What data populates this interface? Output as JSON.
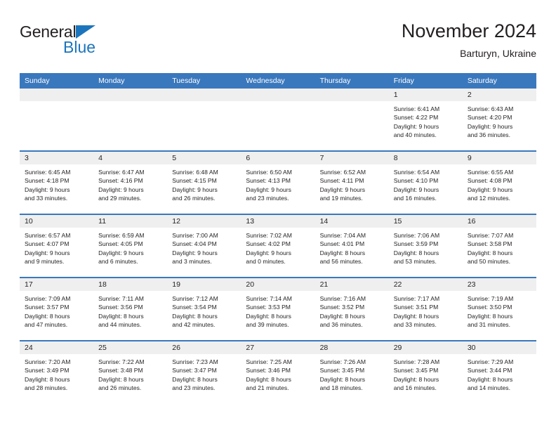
{
  "brand": {
    "name_part1": "General",
    "name_part2": "Blue",
    "triangle_color": "#1c75bc"
  },
  "header": {
    "title": "November 2024",
    "subtitle": "Barturyn, Ukraine"
  },
  "theme": {
    "header_bg": "#3a78bd",
    "daynum_bg": "#efefef",
    "text": "#231f20",
    "row_border": "#3a78bd"
  },
  "weekday_headers": [
    "Sunday",
    "Monday",
    "Tuesday",
    "Wednesday",
    "Thursday",
    "Friday",
    "Saturday"
  ],
  "weeks": [
    [
      {
        "day": "",
        "sunrise": "",
        "sunset": "",
        "daylight1": "",
        "daylight2": "",
        "empty": true
      },
      {
        "day": "",
        "sunrise": "",
        "sunset": "",
        "daylight1": "",
        "daylight2": "",
        "empty": true
      },
      {
        "day": "",
        "sunrise": "",
        "sunset": "",
        "daylight1": "",
        "daylight2": "",
        "empty": true
      },
      {
        "day": "",
        "sunrise": "",
        "sunset": "",
        "daylight1": "",
        "daylight2": "",
        "empty": true
      },
      {
        "day": "",
        "sunrise": "",
        "sunset": "",
        "daylight1": "",
        "daylight2": "",
        "empty": true
      },
      {
        "day": "1",
        "sunrise": "Sunrise: 6:41 AM",
        "sunset": "Sunset: 4:22 PM",
        "daylight1": "Daylight: 9 hours",
        "daylight2": "and 40 minutes.",
        "empty": false
      },
      {
        "day": "2",
        "sunrise": "Sunrise: 6:43 AM",
        "sunset": "Sunset: 4:20 PM",
        "daylight1": "Daylight: 9 hours",
        "daylight2": "and 36 minutes.",
        "empty": false
      }
    ],
    [
      {
        "day": "3",
        "sunrise": "Sunrise: 6:45 AM",
        "sunset": "Sunset: 4:18 PM",
        "daylight1": "Daylight: 9 hours",
        "daylight2": "and 33 minutes.",
        "empty": false
      },
      {
        "day": "4",
        "sunrise": "Sunrise: 6:47 AM",
        "sunset": "Sunset: 4:16 PM",
        "daylight1": "Daylight: 9 hours",
        "daylight2": "and 29 minutes.",
        "empty": false
      },
      {
        "day": "5",
        "sunrise": "Sunrise: 6:48 AM",
        "sunset": "Sunset: 4:15 PM",
        "daylight1": "Daylight: 9 hours",
        "daylight2": "and 26 minutes.",
        "empty": false
      },
      {
        "day": "6",
        "sunrise": "Sunrise: 6:50 AM",
        "sunset": "Sunset: 4:13 PM",
        "daylight1": "Daylight: 9 hours",
        "daylight2": "and 23 minutes.",
        "empty": false
      },
      {
        "day": "7",
        "sunrise": "Sunrise: 6:52 AM",
        "sunset": "Sunset: 4:11 PM",
        "daylight1": "Daylight: 9 hours",
        "daylight2": "and 19 minutes.",
        "empty": false
      },
      {
        "day": "8",
        "sunrise": "Sunrise: 6:54 AM",
        "sunset": "Sunset: 4:10 PM",
        "daylight1": "Daylight: 9 hours",
        "daylight2": "and 16 minutes.",
        "empty": false
      },
      {
        "day": "9",
        "sunrise": "Sunrise: 6:55 AM",
        "sunset": "Sunset: 4:08 PM",
        "daylight1": "Daylight: 9 hours",
        "daylight2": "and 12 minutes.",
        "empty": false
      }
    ],
    [
      {
        "day": "10",
        "sunrise": "Sunrise: 6:57 AM",
        "sunset": "Sunset: 4:07 PM",
        "daylight1": "Daylight: 9 hours",
        "daylight2": "and 9 minutes.",
        "empty": false
      },
      {
        "day": "11",
        "sunrise": "Sunrise: 6:59 AM",
        "sunset": "Sunset: 4:05 PM",
        "daylight1": "Daylight: 9 hours",
        "daylight2": "and 6 minutes.",
        "empty": false
      },
      {
        "day": "12",
        "sunrise": "Sunrise: 7:00 AM",
        "sunset": "Sunset: 4:04 PM",
        "daylight1": "Daylight: 9 hours",
        "daylight2": "and 3 minutes.",
        "empty": false
      },
      {
        "day": "13",
        "sunrise": "Sunrise: 7:02 AM",
        "sunset": "Sunset: 4:02 PM",
        "daylight1": "Daylight: 9 hours",
        "daylight2": "and 0 minutes.",
        "empty": false
      },
      {
        "day": "14",
        "sunrise": "Sunrise: 7:04 AM",
        "sunset": "Sunset: 4:01 PM",
        "daylight1": "Daylight: 8 hours",
        "daylight2": "and 56 minutes.",
        "empty": false
      },
      {
        "day": "15",
        "sunrise": "Sunrise: 7:06 AM",
        "sunset": "Sunset: 3:59 PM",
        "daylight1": "Daylight: 8 hours",
        "daylight2": "and 53 minutes.",
        "empty": false
      },
      {
        "day": "16",
        "sunrise": "Sunrise: 7:07 AM",
        "sunset": "Sunset: 3:58 PM",
        "daylight1": "Daylight: 8 hours",
        "daylight2": "and 50 minutes.",
        "empty": false
      }
    ],
    [
      {
        "day": "17",
        "sunrise": "Sunrise: 7:09 AM",
        "sunset": "Sunset: 3:57 PM",
        "daylight1": "Daylight: 8 hours",
        "daylight2": "and 47 minutes.",
        "empty": false
      },
      {
        "day": "18",
        "sunrise": "Sunrise: 7:11 AM",
        "sunset": "Sunset: 3:56 PM",
        "daylight1": "Daylight: 8 hours",
        "daylight2": "and 44 minutes.",
        "empty": false
      },
      {
        "day": "19",
        "sunrise": "Sunrise: 7:12 AM",
        "sunset": "Sunset: 3:54 PM",
        "daylight1": "Daylight: 8 hours",
        "daylight2": "and 42 minutes.",
        "empty": false
      },
      {
        "day": "20",
        "sunrise": "Sunrise: 7:14 AM",
        "sunset": "Sunset: 3:53 PM",
        "daylight1": "Daylight: 8 hours",
        "daylight2": "and 39 minutes.",
        "empty": false
      },
      {
        "day": "21",
        "sunrise": "Sunrise: 7:16 AM",
        "sunset": "Sunset: 3:52 PM",
        "daylight1": "Daylight: 8 hours",
        "daylight2": "and 36 minutes.",
        "empty": false
      },
      {
        "day": "22",
        "sunrise": "Sunrise: 7:17 AM",
        "sunset": "Sunset: 3:51 PM",
        "daylight1": "Daylight: 8 hours",
        "daylight2": "and 33 minutes.",
        "empty": false
      },
      {
        "day": "23",
        "sunrise": "Sunrise: 7:19 AM",
        "sunset": "Sunset: 3:50 PM",
        "daylight1": "Daylight: 8 hours",
        "daylight2": "and 31 minutes.",
        "empty": false
      }
    ],
    [
      {
        "day": "24",
        "sunrise": "Sunrise: 7:20 AM",
        "sunset": "Sunset: 3:49 PM",
        "daylight1": "Daylight: 8 hours",
        "daylight2": "and 28 minutes.",
        "empty": false
      },
      {
        "day": "25",
        "sunrise": "Sunrise: 7:22 AM",
        "sunset": "Sunset: 3:48 PM",
        "daylight1": "Daylight: 8 hours",
        "daylight2": "and 26 minutes.",
        "empty": false
      },
      {
        "day": "26",
        "sunrise": "Sunrise: 7:23 AM",
        "sunset": "Sunset: 3:47 PM",
        "daylight1": "Daylight: 8 hours",
        "daylight2": "and 23 minutes.",
        "empty": false
      },
      {
        "day": "27",
        "sunrise": "Sunrise: 7:25 AM",
        "sunset": "Sunset: 3:46 PM",
        "daylight1": "Daylight: 8 hours",
        "daylight2": "and 21 minutes.",
        "empty": false
      },
      {
        "day": "28",
        "sunrise": "Sunrise: 7:26 AM",
        "sunset": "Sunset: 3:45 PM",
        "daylight1": "Daylight: 8 hours",
        "daylight2": "and 18 minutes.",
        "empty": false
      },
      {
        "day": "29",
        "sunrise": "Sunrise: 7:28 AM",
        "sunset": "Sunset: 3:45 PM",
        "daylight1": "Daylight: 8 hours",
        "daylight2": "and 16 minutes.",
        "empty": false
      },
      {
        "day": "30",
        "sunrise": "Sunrise: 7:29 AM",
        "sunset": "Sunset: 3:44 PM",
        "daylight1": "Daylight: 8 hours",
        "daylight2": "and 14 minutes.",
        "empty": false
      }
    ]
  ]
}
